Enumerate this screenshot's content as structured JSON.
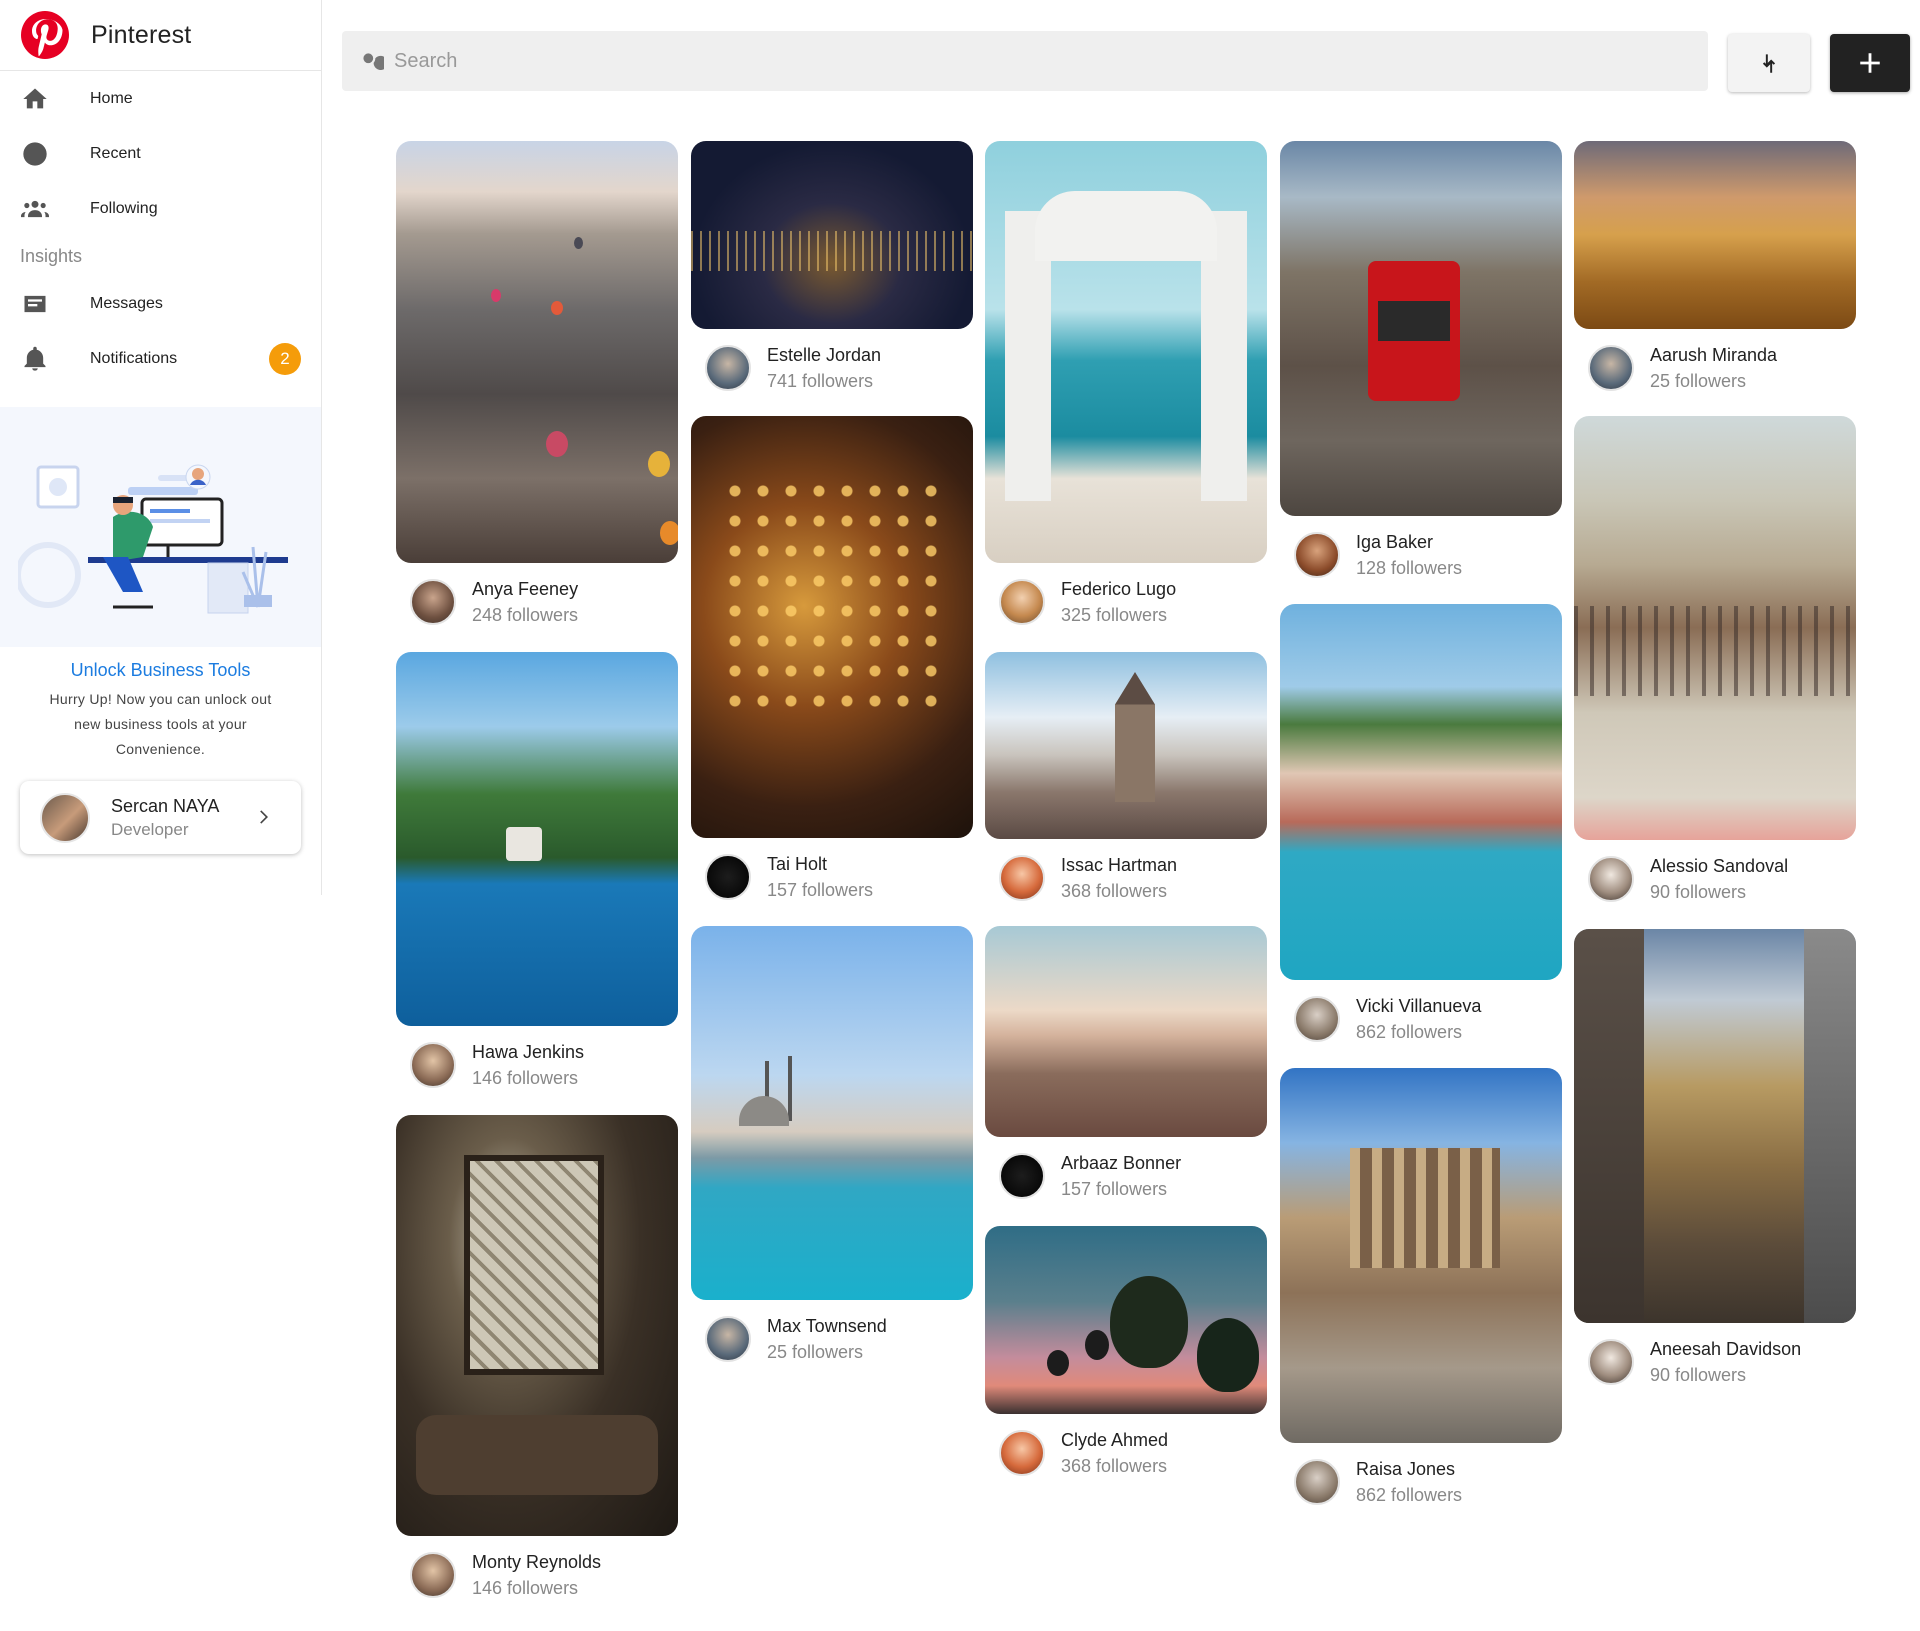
{
  "brand": {
    "name": "Pinterest"
  },
  "nav": {
    "items": [
      {
        "label": "Home",
        "icon": "home-icon"
      },
      {
        "label": "Recent",
        "icon": "clock-icon"
      },
      {
        "label": "Following",
        "icon": "people-icon"
      }
    ],
    "section_label": "Insights",
    "items2": [
      {
        "label": "Messages",
        "icon": "message-icon"
      },
      {
        "label": "Notifications",
        "icon": "bell-icon",
        "badge": "2"
      }
    ]
  },
  "promo": {
    "title": "Unlock Business Tools",
    "text": "Hurry Up! Now you can unlock out new business tools at your Convenience."
  },
  "user": {
    "name": "Sercan NAYA",
    "role": "Developer"
  },
  "search": {
    "placeholder": "Search"
  },
  "colors": {
    "brand_red": "#e60023",
    "link_blue": "#1c7ce0",
    "badge_orange": "#f59c0a",
    "dark_button": "#222222"
  },
  "pins": [
    {
      "name": "Anya Feeney",
      "followers": "248 followers",
      "image": "cappadocia-balloons"
    },
    {
      "name": "Hawa Jenkins",
      "followers": "146 followers",
      "image": "bay-with-boat"
    },
    {
      "name": "Monty Reynolds",
      "followers": "146 followers",
      "image": "ornate-window"
    },
    {
      "name": "Estelle Jordan",
      "followers": "741 followers",
      "image": "city-at-night"
    },
    {
      "name": "Tai Holt",
      "followers": "157 followers",
      "image": "bazaar-lamps"
    },
    {
      "name": "Max Townsend",
      "followers": "25 followers",
      "image": "mosque-by-sea"
    },
    {
      "name": "Federico Lugo",
      "followers": "325 followers",
      "image": "marble-gate"
    },
    {
      "name": "Issac Hartman",
      "followers": "368 followers",
      "image": "galata-tower"
    },
    {
      "name": "Arbaaz Bonner",
      "followers": "157 followers",
      "image": "coastal-city"
    },
    {
      "name": "Clyde Ahmed",
      "followers": "368 followers",
      "image": "balloons-at-dusk"
    },
    {
      "name": "Iga Baker",
      "followers": "128 followers",
      "image": "red-tram"
    },
    {
      "name": "Vicki Villanueva",
      "followers": "862 followers",
      "image": "bosphorus-town"
    },
    {
      "name": "Raisa Jones",
      "followers": "862 followers",
      "image": "ephesus-library"
    },
    {
      "name": "Aarush Miranda",
      "followers": "25 followers",
      "image": "sunset-balloons"
    },
    {
      "name": "Alessio Sandoval",
      "followers": "90 followers",
      "image": "square-crowd"
    },
    {
      "name": "Aneesah Davidson",
      "followers": "90 followers",
      "image": "old-street"
    }
  ]
}
